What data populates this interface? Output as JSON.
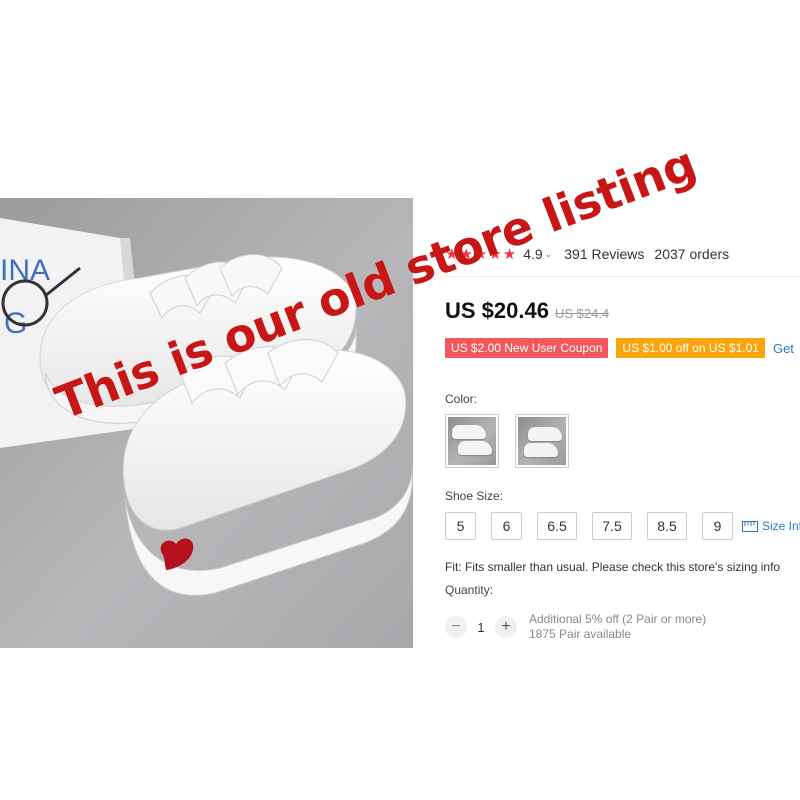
{
  "rating": {
    "value": "4.9",
    "reviews": "391 Reviews",
    "orders": "2037 orders",
    "stars": "★★★★★"
  },
  "price": {
    "current": "US $20.46",
    "original": "US $24.4"
  },
  "promos": {
    "coupon_red": "US $2.00 New User Coupon",
    "coupon_orange": "US $1.00 off on US $1.01",
    "get_link": "Get"
  },
  "color": {
    "label": "Color:"
  },
  "size": {
    "label": "Shoe Size:",
    "options": [
      "5",
      "6",
      "6.5",
      "7.5",
      "8.5",
      "9"
    ],
    "info_link": "Size Info"
  },
  "fit_text": "Fit: Fits smaller than usual. Please check this store's sizing info",
  "quantity": {
    "label": "Quantity:",
    "value": "1",
    "discount_note": "Additional 5% off (2 Pair or more)",
    "availability": "1875 Pair available"
  },
  "photo": {
    "book_text": [
      "INA",
      "G"
    ]
  },
  "watermark": "This is our old store listing",
  "colors": {
    "accent_red": "#f5344a",
    "coupon_red": "#f5585c",
    "coupon_orange": "#f9a50b",
    "link_blue": "#2b79c2",
    "watermark": "#c81616"
  }
}
